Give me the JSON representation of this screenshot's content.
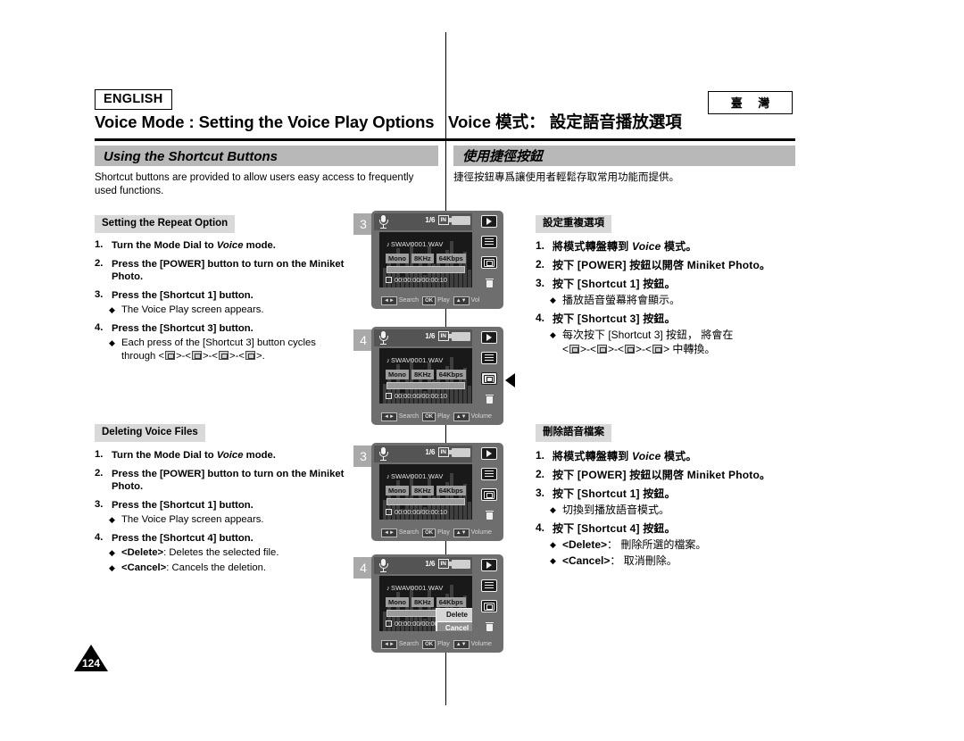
{
  "header": {
    "language_badge": "ENGLISH",
    "region_badge": "臺 灣",
    "title_en": "Voice Mode : Setting the Voice Play Options",
    "title_zh": "Voice 模式： 設定語音播放選項"
  },
  "section": {
    "bar_en": "Using the Shortcut Buttons",
    "bar_zh": "使用捷徑按鈕",
    "intro_en": "Shortcut buttons are provided to allow users easy access to frequently used functions.",
    "intro_zh": "捷徑按鈕專爲讓使用者輕鬆存取常用功能而提供。"
  },
  "repeat_en": {
    "chip": "Setting the Repeat Option",
    "steps": [
      {
        "num": "1.",
        "pre": "Turn the Mode Dial to ",
        "em": "Voice",
        "post": " mode."
      },
      {
        "num": "2.",
        "pre": "Press the [POWER] button to turn on the Miniket Photo.",
        "em": "",
        "post": ""
      },
      {
        "num": "3.",
        "pre": "Press the [Shortcut 1] button.",
        "em": "",
        "post": ""
      },
      {
        "num": "4.",
        "pre": "Press the [Shortcut 3] button.",
        "em": "",
        "post": ""
      }
    ],
    "bullet_3": "The Voice Play screen appears.",
    "bullet_4a": "Each press of the [Shortcut 3] button cycles",
    "bullet_4b_pre": "through <",
    "bullet_4b_post": ">."
  },
  "repeat_zh": {
    "chip": "設定重複選項",
    "steps": [
      {
        "num": "1.",
        "pre": "將模式轉盤轉到 ",
        "em": "Voice",
        "post": " 模式。"
      },
      {
        "num": "2.",
        "pre": "按下 [POWER] 按鈕以開啓 Miniket Photo。",
        "em": "",
        "post": ""
      },
      {
        "num": "3.",
        "pre": "按下 [Shortcut 1] 按鈕。",
        "em": "",
        "post": ""
      },
      {
        "num": "4.",
        "pre": "按下 [Shortcut 3] 按鈕。",
        "em": "",
        "post": ""
      }
    ],
    "bullet_3": "播放語音螢幕將會顯示。",
    "bullet_4a": "每次按下 [Shortcut 3] 按鈕， 將會在",
    "bullet_4b_pre": "<",
    "bullet_4b_post": "> 中轉換。"
  },
  "delete_en": {
    "chip": "Deleting Voice Files",
    "steps": [
      {
        "num": "1.",
        "pre": "Turn the Mode Dial to ",
        "em": "Voice",
        "post": " mode."
      },
      {
        "num": "2.",
        "pre": "Press the [POWER] button to turn on the Miniket Photo.",
        "em": "",
        "post": ""
      },
      {
        "num": "3.",
        "pre": "Press the [Shortcut 1] button.",
        "em": "",
        "post": ""
      },
      {
        "num": "4.",
        "pre": "Press the [Shortcut 4] button.",
        "em": "",
        "post": ""
      }
    ],
    "bullet_3": "The Voice Play screen appears.",
    "bullet_4a_key": "<Delete>",
    "bullet_4a_rest": ": Deletes the selected file.",
    "bullet_4b_key": "<Cancel>",
    "bullet_4b_rest": ": Cancels the deletion."
  },
  "delete_zh": {
    "chip": "刪除語音檔案",
    "steps": [
      {
        "num": "1.",
        "pre": "將模式轉盤轉到 ",
        "em": "Voice",
        "post": " 模式。"
      },
      {
        "num": "2.",
        "pre": "按下 [POWER] 按鈕以開啓 Miniket Photo。",
        "em": "",
        "post": ""
      },
      {
        "num": "3.",
        "pre": "按下 [Shortcut 1] 按鈕。",
        "em": "",
        "post": ""
      },
      {
        "num": "4.",
        "pre": "按下 [Shortcut 4] 按鈕。",
        "em": "",
        "post": ""
      }
    ],
    "bullet_3": "切換到播放語音模式。",
    "bullet_4a_key": "<Delete>",
    "bullet_4a_rest": "： 刪除所選的檔案。",
    "bullet_4b_key": "<Cancel>",
    "bullet_4b_rest": "： 取消刪除。"
  },
  "devices": [
    {
      "step": "3",
      "page_counter": "1/6",
      "storage": "IN",
      "filename": "SWAV0001.WAV",
      "tags": [
        "Mono",
        "8KHz",
        "64Kbps"
      ],
      "timecode": "00:00:00/00:00:10",
      "hints": [
        {
          "key": "◄►",
          "label": "Search"
        },
        {
          "key": "OK",
          "label": "Play"
        },
        {
          "key": "▲▼",
          "label": "Vol"
        }
      ],
      "popup": null,
      "highlight_repeat": false,
      "pointer": false
    },
    {
      "step": "4",
      "page_counter": "1/6",
      "storage": "IN",
      "filename": "SWAV0001.WAV",
      "tags": [
        "Mono",
        "8KHz",
        "64Kbps"
      ],
      "timecode": "00:00:00/00:00:10",
      "hints": [
        {
          "key": "◄►",
          "label": "Search"
        },
        {
          "key": "OK",
          "label": "Play"
        },
        {
          "key": "▲▼",
          "label": "Volume"
        }
      ],
      "popup": null,
      "highlight_repeat": true,
      "pointer": true
    },
    {
      "step": "3",
      "page_counter": "1/6",
      "storage": "IN",
      "filename": "SWAV0001.WAV",
      "tags": [
        "Mono",
        "8KHz",
        "64Kbps"
      ],
      "timecode": "00:00:00/00:00:10",
      "hints": [
        {
          "key": "◄►",
          "label": "Search"
        },
        {
          "key": "OK",
          "label": "Play"
        },
        {
          "key": "▲▼",
          "label": "Volume"
        }
      ],
      "popup": null,
      "highlight_repeat": false,
      "pointer": false
    },
    {
      "step": "4",
      "page_counter": "1/6",
      "storage": "IN",
      "filename": "SWAV0001.WAV",
      "tags": [
        "Mono",
        "8KHz",
        "64Kbps"
      ],
      "timecode": "00:00:00/00:00:1",
      "hints": [
        {
          "key": "◄►",
          "label": "Search"
        },
        {
          "key": "OK",
          "label": "Play"
        },
        {
          "key": "▲▼",
          "label": "Volume"
        }
      ],
      "popup": {
        "delete": "Delete",
        "cancel": "Cancel",
        "selected": "Cancel"
      },
      "highlight_repeat": false,
      "pointer": false
    }
  ],
  "footer": {
    "page_number": "124"
  }
}
